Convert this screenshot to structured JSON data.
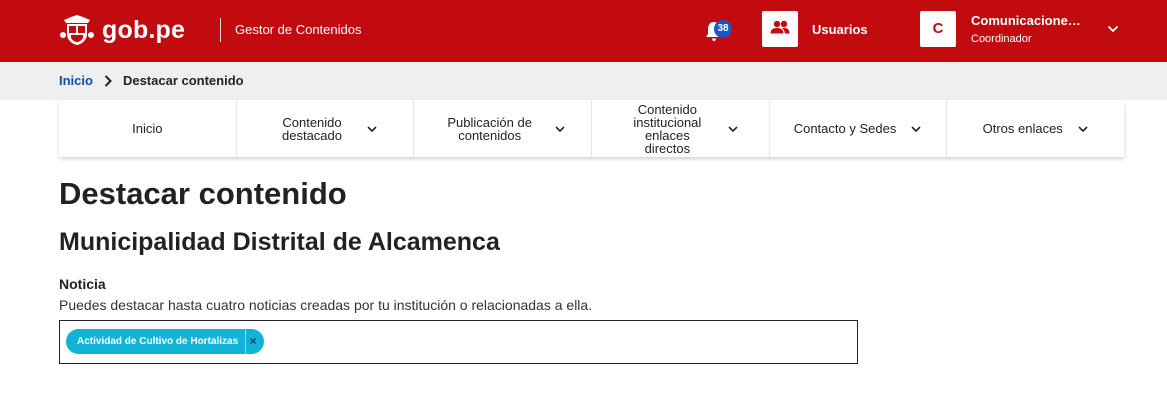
{
  "header": {
    "logo_text": "gob.pe",
    "app_name": "Gestor de Contenidos",
    "notifications_count": "38",
    "users_label": "Usuarios",
    "user_initial": "C",
    "user_name": "Comunicaciones ...",
    "user_role": "Coordinador"
  },
  "breadcrumb": {
    "home": "Inicio",
    "current": "Destacar contenido"
  },
  "nav": {
    "items": [
      {
        "label": "Inicio",
        "has_dropdown": false
      },
      {
        "label": "Contenido destacado",
        "has_dropdown": true
      },
      {
        "label": "Publicación de contenidos",
        "has_dropdown": true
      },
      {
        "label": "Contenido institucional enlaces directos",
        "has_dropdown": true
      },
      {
        "label": "Contacto y Sedes",
        "has_dropdown": true
      },
      {
        "label": "Otros enlaces",
        "has_dropdown": true
      }
    ]
  },
  "main": {
    "title": "Destacar contenido",
    "subtitle": "Municipalidad Distrital de Alcamenca",
    "field": {
      "label": "Noticia",
      "help": "Puedes destacar hasta cuatro noticias creadas por tu institución o relacionadas a ella.",
      "tags": [
        "Actividad de Cultivo de Hortalizas"
      ],
      "remove_symbol": "×"
    }
  },
  "colors": {
    "brand_red": "#c10b0e",
    "badge_blue": "#1b56c4",
    "tag_cyan": "#12b4d6",
    "link_blue": "#0b4ea2"
  },
  "icons": {
    "logo": "peru-coat-of-arms-icon",
    "notifications": "bell-icon",
    "users": "users-icon",
    "user_menu": "chevron-down-icon",
    "breadcrumb_separator": "chevron-right-icon",
    "nav_dropdown": "chevron-down-icon"
  }
}
